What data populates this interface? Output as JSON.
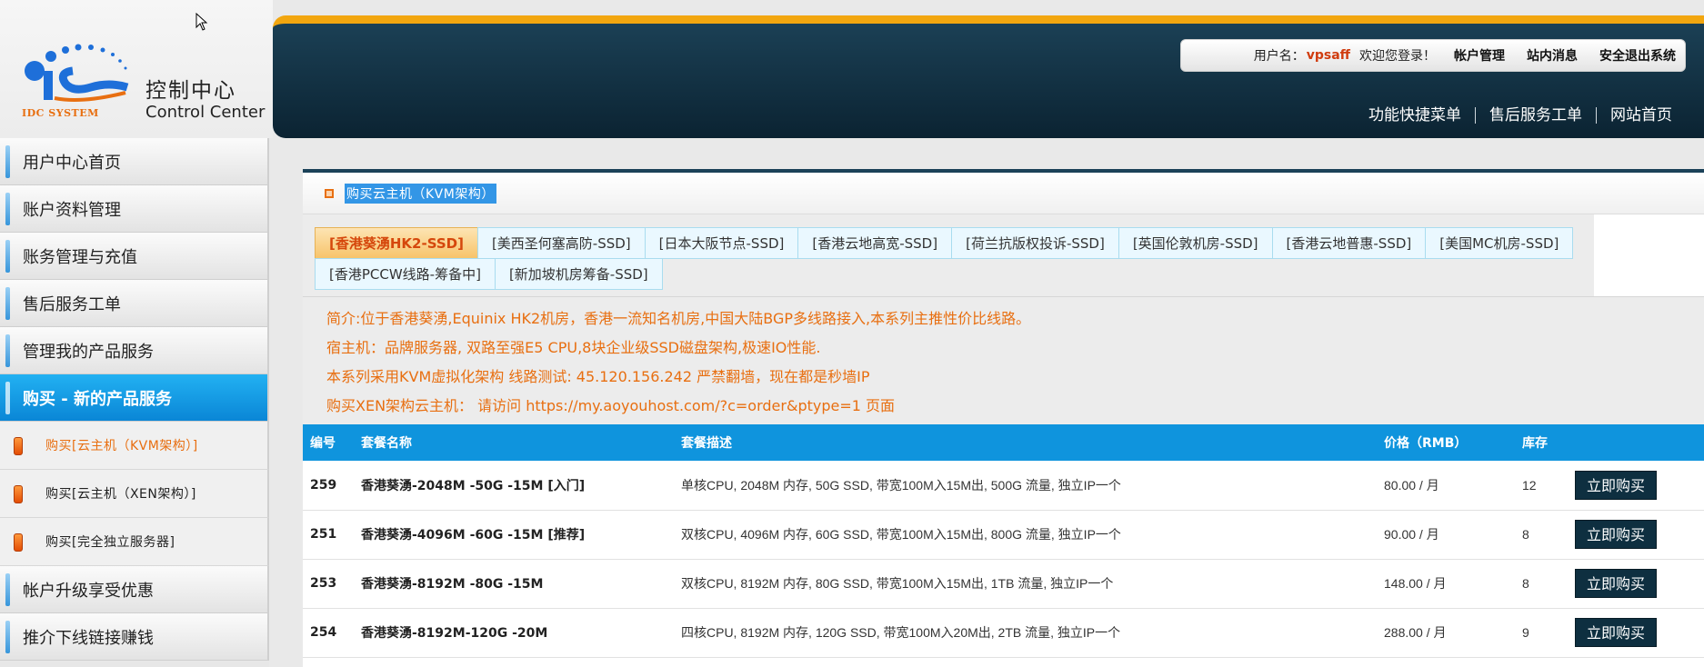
{
  "logo": {
    "cn": "控制中心",
    "en": "Control Center",
    "sub": "IDC SYSTEM",
    "mark": "iS"
  },
  "header": {
    "username_label": "用户名：",
    "username": "vpsaff",
    "welcome": "欢迎您登录！",
    "links": [
      "帐户管理",
      "站内消息",
      "安全退出系统"
    ],
    "quick_links": [
      "功能快捷菜单",
      "售后服务工单",
      "网站首页"
    ]
  },
  "sidebar": {
    "items": [
      {
        "label": "用户中心首页"
      },
      {
        "label": "账户资料管理"
      },
      {
        "label": "账务管理与充值"
      },
      {
        "label": "售后服务工单"
      },
      {
        "label": "管理我的产品服务"
      },
      {
        "label": "购买 - 新的产品服务"
      }
    ],
    "sub_items": [
      {
        "label": "购买[云主机（KVM架构）]"
      },
      {
        "label": "购买[云主机（XEN架构）]"
      },
      {
        "label": "购买[完全独立服务器]"
      }
    ],
    "bottom_items": [
      {
        "label": "帐户升级享受优惠"
      },
      {
        "label": "推介下线链接赚钱"
      }
    ]
  },
  "panel": {
    "title": "购买云主机（KVM架构）",
    "tabs": [
      "[香港葵湧HK2-SSD]",
      "[美西圣何塞高防-SSD]",
      "[日本大阪节点-SSD]",
      "[香港云地高宽-SSD]",
      "[荷兰抗版权投诉-SSD]",
      "[英国伦敦机房-SSD]",
      "[香港云地普惠-SSD]",
      "[美国MC机房-SSD]",
      "[香港PCCW线路-筹备中]",
      "[新加坡机房筹备-SSD]"
    ],
    "intro": [
      "简介:位于香港葵湧,Equinix HK2机房，香港一流知名机房,中国大陆BGP多线路接入,本系列主推性价比线路。",
      "宿主机：品牌服务器, 双路至强E5 CPU,8块企业级SSD磁盘架构,极速IO性能.",
      "本系列采用KVM虚拟化架构 线路测试: 45.120.156.242 严禁翻墙，现在都是秒墙IP",
      "购买XEN架构云主机： 请访问 https://my.aoyouhost.com/?c=order&ptype=1 页面"
    ],
    "table": {
      "headers": {
        "id": "编号",
        "name": "套餐名称",
        "desc": "套餐描述",
        "price": "价格（RMB）",
        "stock": "库存"
      },
      "buy_label": "立即购买",
      "rows": [
        {
          "id": "259",
          "name": "香港葵湧-2048M -50G -15M [入门]",
          "desc": "单核CPU, 2048M 内存, 50G SSD, 带宽100M入15M出, 500G 流量, 独立IP一个",
          "price": "80.00 / 月",
          "stock": "12"
        },
        {
          "id": "251",
          "name": "香港葵湧-4096M -60G -15M [推荐]",
          "desc": "双核CPU, 4096M 内存, 60G SSD, 带宽100M入15M出, 800G 流量, 独立IP一个",
          "price": "90.00 / 月",
          "stock": "8"
        },
        {
          "id": "253",
          "name": "香港葵湧-8192M -80G -15M",
          "desc": "双核CPU, 8192M 内存, 80G SSD, 带宽100M入15M出, 1TB 流量, 独立IP一个",
          "price": "148.00 / 月",
          "stock": "8"
        },
        {
          "id": "254",
          "name": "香港葵湧-8192M-120G -20M",
          "desc": "四核CPU, 8192M 内存, 120G SSD, 带宽100M入20M出, 2TB 流量, 独立IP一个",
          "price": "288.00 / 月",
          "stock": "9"
        }
      ]
    }
  }
}
